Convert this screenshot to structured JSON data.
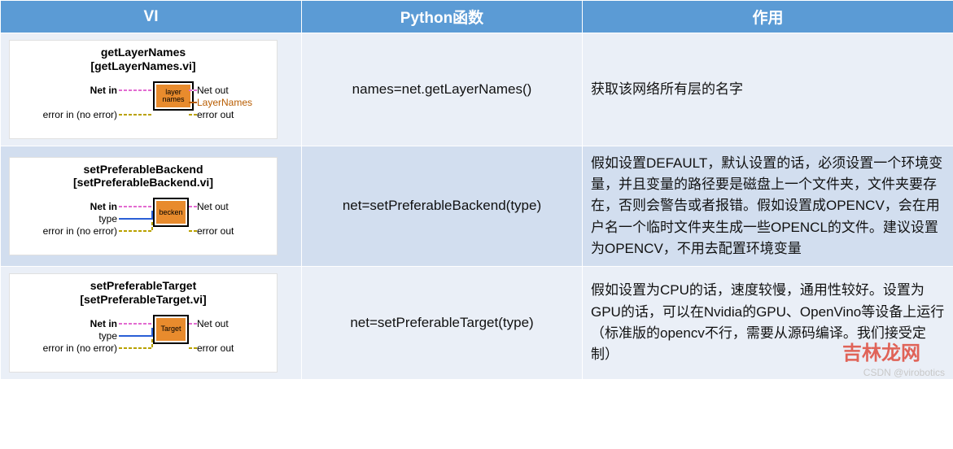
{
  "headers": {
    "vi": "VI",
    "python": "Python函数",
    "desc": "作用"
  },
  "rows": [
    {
      "vi": {
        "title": "getLayerNames",
        "subtitle": "[getLayerNames.vi]",
        "chip": "layer names",
        "netin": "Net in",
        "type": "",
        "errin": "error in (no error)",
        "netout": "Net out",
        "extra": "LayerNames",
        "errout": "error out"
      },
      "python": "names=net.getLayerNames()",
      "desc": "获取该网络所有层的名字"
    },
    {
      "vi": {
        "title": "setPreferableBackend",
        "subtitle": "[setPreferableBackend.vi]",
        "chip": "becken",
        "netin": "Net in",
        "type": "type",
        "errin": "error in (no error)",
        "netout": "Net out",
        "extra": "",
        "errout": "error out"
      },
      "python": "net=setPreferableBackend(type)",
      "desc": "假如设置DEFAULT，默认设置的话，必须设置一个环境变量，并且变量的路径要是磁盘上一个文件夹，文件夹要存在，否则会警告或者报错。假如设置成OPENCV，会在用户名一个临时文件夹生成一些OPENCL的文件。建议设置为OPENCV，不用去配置环境变量"
    },
    {
      "vi": {
        "title": "setPreferableTarget",
        "subtitle": "[setPreferableTarget.vi]",
        "chip": "Target",
        "netin": "Net in",
        "type": "type",
        "errin": "error in (no error)",
        "netout": "Net out",
        "extra": "",
        "errout": "error out"
      },
      "python": "net=setPreferableTarget(type)",
      "desc": "假如设置为CPU的话，速度较慢，通用性较好。设置为GPU的话，可以在Nvidia的GPU、OpenVino等设备上运行（标准版的opencv不行，需要从源码编译。我们接受定制）"
    }
  ],
  "watermark": "吉林龙网",
  "attribution": "CSDN @virobotics"
}
